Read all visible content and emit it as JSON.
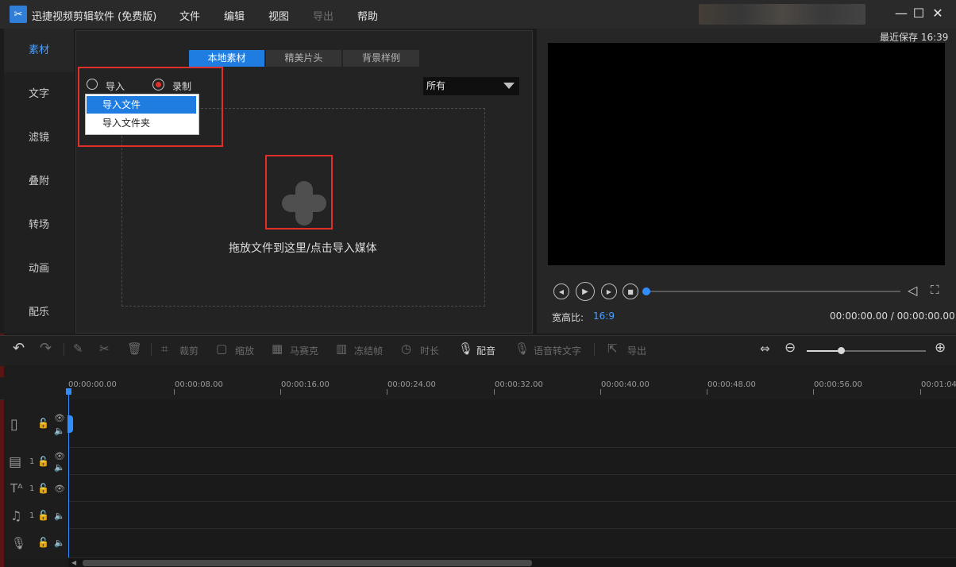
{
  "app": {
    "title": "迅捷视频剪辑软件 (免费版)",
    "menu": [
      "文件",
      "编辑",
      "视图",
      "导出",
      "帮助"
    ],
    "last_saved": "最近保存 16:39"
  },
  "sidebar": {
    "items": [
      "素材",
      "文字",
      "滤镜",
      "叠附",
      "转场",
      "动画",
      "配乐"
    ],
    "active_index": 0
  },
  "media": {
    "tabs": [
      "本地素材",
      "精美片头",
      "背景样例"
    ],
    "active_tab": 0,
    "import_label": "导入",
    "record_label": "录制",
    "filter_value": "所有",
    "dropdown_items": [
      "导入文件",
      "导入文件夹"
    ],
    "dropzone_hint": "拖放文件到这里/点击导入媒体"
  },
  "preview": {
    "aspect_label": "宽高比:",
    "aspect_value": "16:9",
    "time_readout": "00:00:00.00 / 00:00:00.00"
  },
  "toolbar": {
    "crop": "裁剪",
    "zoom": "缩放",
    "mosaic": "马赛克",
    "freeze": "冻结帧",
    "duration": "时长",
    "dub": "配音",
    "speech_to_text": "语音转文字",
    "export": "导出"
  },
  "timeline": {
    "ticks": [
      "00:00:00.00",
      "00:00:08.00",
      "00:00:16.00",
      "00:00:24.00",
      "00:00:32.00",
      "00:00:40.00",
      "00:00:48.00",
      "00:00:56.00",
      "00:01:04"
    ],
    "track_nums": [
      "1",
      "1",
      "1"
    ]
  },
  "colors": {
    "accent": "#1f7de2",
    "highlight": "#e0302a"
  }
}
